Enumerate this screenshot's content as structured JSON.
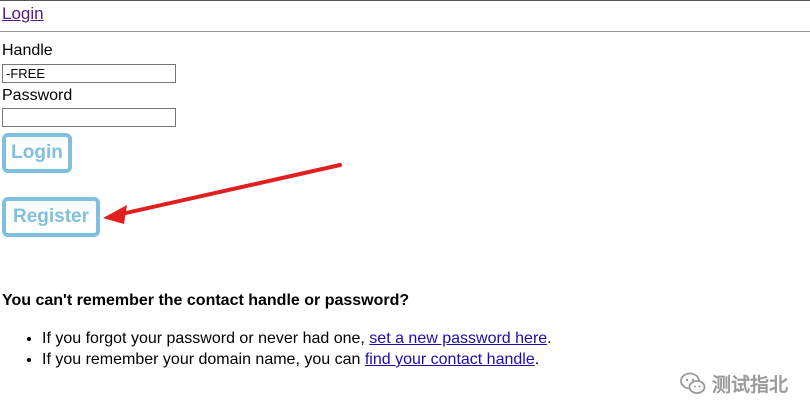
{
  "header": {
    "login_link": "Login"
  },
  "form": {
    "handle_label": "Handle",
    "handle_value": "-FREE",
    "password_label": "Password",
    "password_value": "",
    "login_button": "Login",
    "register_button": "Register"
  },
  "help": {
    "heading": "You can't remember the contact handle or password?",
    "items": [
      {
        "prefix": "If you forgot your password or never had one, ",
        "link": "set a new password here",
        "suffix": "."
      },
      {
        "prefix": "If you remember your domain name, you can ",
        "link": "find your contact handle",
        "suffix": "."
      }
    ]
  },
  "annotation": {
    "arrow_color": "#e02020",
    "button_border_color": "#7fbfdf"
  },
  "watermark": {
    "text": "测试指北",
    "icon": "wechat-icon"
  }
}
